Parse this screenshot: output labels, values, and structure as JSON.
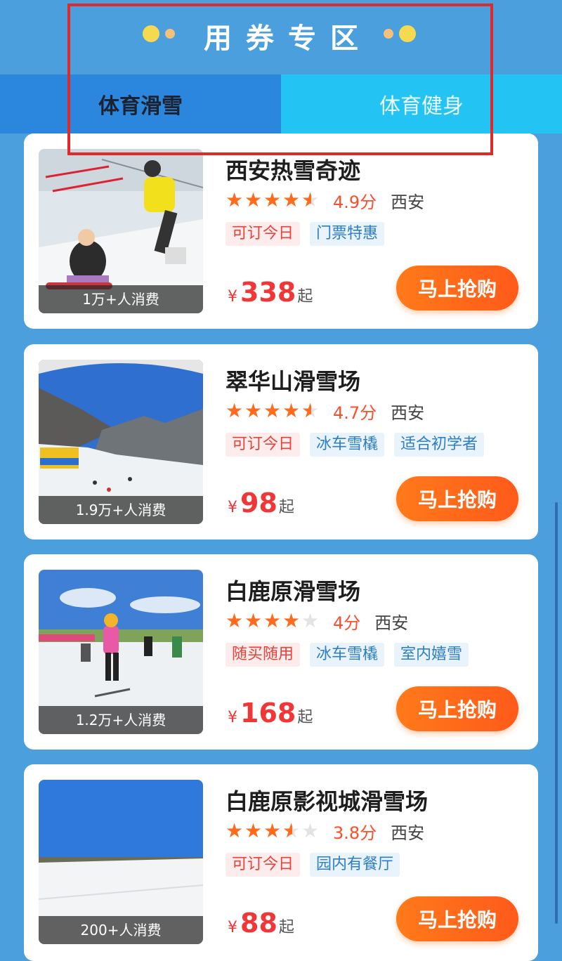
{
  "header": {
    "title": "用券专区"
  },
  "tabs": [
    {
      "label": "体育滑雪",
      "active": true
    },
    {
      "label": "体育健身",
      "active": false
    }
  ],
  "button_label": "马上抢购",
  "price_symbol": "¥",
  "price_suffix": "起",
  "cards": [
    {
      "title": "西安热雪奇迹",
      "rating": 4.5,
      "score": "4.9分",
      "city": "西安",
      "tags": [
        {
          "text": "可订今日",
          "color": "red"
        },
        {
          "text": "门票特惠",
          "color": "blue"
        }
      ],
      "price": "338",
      "caption": "1万+人消费",
      "thumb_icon": "ski-photo-indoor"
    },
    {
      "title": "翠华山滑雪场",
      "rating": 4.5,
      "score": "4.7分",
      "city": "西安",
      "tags": [
        {
          "text": "可订今日",
          "color": "red"
        },
        {
          "text": "冰车雪橇",
          "color": "blue"
        },
        {
          "text": "适合初学者",
          "color": "blue"
        }
      ],
      "price": "98",
      "caption": "1.9万+人消费",
      "thumb_icon": "ski-photo-mountain"
    },
    {
      "title": "白鹿原滑雪场",
      "rating": 4,
      "score": "4分",
      "city": "西安",
      "tags": [
        {
          "text": "随买随用",
          "color": "red"
        },
        {
          "text": "冰车雪橇",
          "color": "blue"
        },
        {
          "text": "室内嬉雪",
          "color": "blue"
        }
      ],
      "price": "168",
      "caption": "1.2万+人消费",
      "thumb_icon": "ski-photo-kids"
    },
    {
      "title": "白鹿原影视城滑雪场",
      "rating": 3.5,
      "score": "3.8分",
      "city": "西安",
      "tags": [
        {
          "text": "可订今日",
          "color": "red"
        },
        {
          "text": "园内有餐厅",
          "color": "blue"
        }
      ],
      "price": "88",
      "caption": "200+人消费",
      "thumb_icon": "ski-photo-field"
    }
  ],
  "colors": {
    "background": "#4a9fdc",
    "accent_orange": "#ff6a1c",
    "price_red": "#f03636",
    "highlight_box": "#e02a2a"
  }
}
